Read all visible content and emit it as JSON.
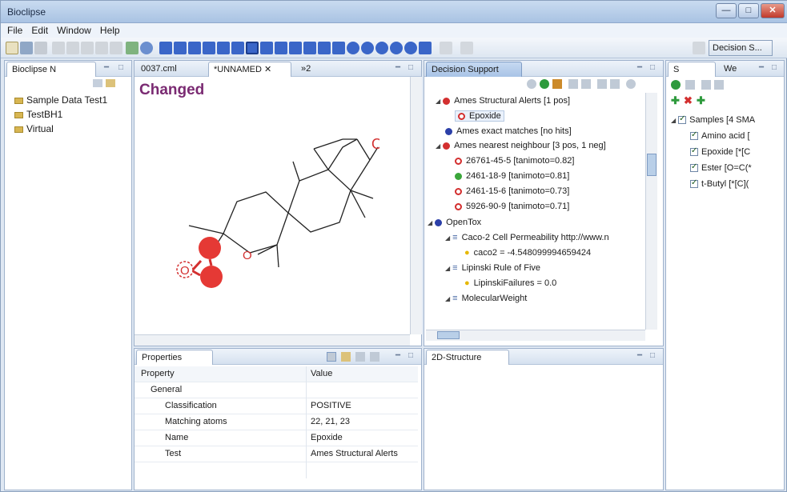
{
  "window": {
    "title": "Bioclipse",
    "min": "—",
    "max": "□",
    "close": "✕"
  },
  "menu": [
    "File",
    "Edit",
    "Window",
    "Help"
  ],
  "perspective_button": "Decision S...",
  "navigator": {
    "tab": "Bioclipse N",
    "items": [
      "Sample Data Test1",
      "TestBH1",
      "Virtual"
    ]
  },
  "editor": {
    "tabs": [
      "0037.cml",
      "*UNNAMED",
      "»2"
    ],
    "changed_label": "Changed"
  },
  "decision": {
    "tab": "Decision Support",
    "rows": [
      {
        "text": "Ames Structural Alerts [1 pos]",
        "color": "#d32f2f"
      },
      {
        "text": "Epoxide",
        "color": "#d32f2f"
      },
      {
        "text": "Ames exact matches [no hits]",
        "color": "#2b3fa8"
      },
      {
        "text": "Ames nearest neighbour [3 pos, 1 neg]",
        "color": "#d32f2f"
      },
      {
        "text": "26761-45-5 [tanimoto=0.82]",
        "color": "#d32f2f"
      },
      {
        "text": "2461-18-9 [tanimoto=0.81]",
        "color": "#3aa63a"
      },
      {
        "text": "2461-15-6 [tanimoto=0.73]",
        "color": "#d32f2f"
      },
      {
        "text": "5926-90-9 [tanimoto=0.71]",
        "color": "#d32f2f"
      },
      {
        "text": "OpenTox",
        "color": "#2b3fa8"
      },
      {
        "text": "Caco-2 Cell Permeability http://www.n",
        "color": ""
      },
      {
        "text": "caco2 = -4.548099994659424",
        "color": ""
      },
      {
        "text": "Lipinski Rule of Five",
        "color": ""
      },
      {
        "text": "LipinskiFailures = 0.0",
        "color": ""
      },
      {
        "text": "MolecularWeight",
        "color": ""
      }
    ]
  },
  "samples": {
    "tabs": [
      "S",
      "We"
    ],
    "root": "Samples [4 SMA",
    "items": [
      "Amino acid [",
      "Epoxide [*[C",
      "Ester [O=C(*",
      "t-Butyl [*[C]("
    ]
  },
  "properties": {
    "tab": "Properties",
    "header_property": "Property",
    "header_value": "Value",
    "group": "General",
    "rows": [
      {
        "key": "Classification",
        "value": "POSITIVE"
      },
      {
        "key": "Matching atoms",
        "value": "22, 21, 23"
      },
      {
        "key": "Name",
        "value": "Epoxide"
      },
      {
        "key": "Test",
        "value": "Ames Structural Alerts"
      }
    ]
  },
  "structure2d": {
    "tab": "2D-Structure"
  }
}
